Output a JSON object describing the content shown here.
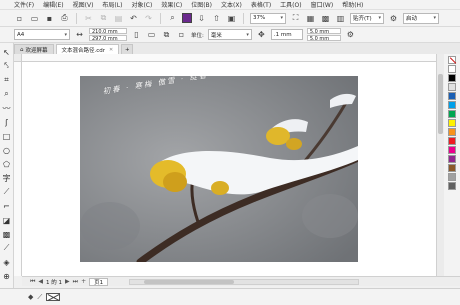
{
  "menu": [
    "文件(F)",
    "编辑(E)",
    "视图(V)",
    "布局(L)",
    "对象(C)",
    "效果(C)",
    "位图(B)",
    "文本(X)",
    "表格(T)",
    "工具(O)",
    "窗口(W)",
    "帮助(H)"
  ],
  "toolbar": {
    "zoom": "37%",
    "snap": "贴齐(T)",
    "launch": "启动"
  },
  "propertybar": {
    "paper": "A4",
    "width": "210.0 mm",
    "height": "297.0 mm",
    "units_label": "单位:",
    "units_value": "毫米",
    "nudge": ".1 mm",
    "dup_x": "5.0 mm",
    "dup_y": "5.0 mm"
  },
  "tabs": {
    "welcome": "欢迎屏幕",
    "document": "文本混合路径.cdr"
  },
  "photo": {
    "caption": "初春 · 寒梅 傲雪 · 绽香"
  },
  "pagebar": {
    "page_counter": "1 的 1",
    "page_tab": "页1"
  },
  "colors": {
    "accent": "#6b2a8e",
    "palette": [
      "#ffffff",
      "#000000",
      "#e0e0e0",
      "#1a5fb4",
      "#00a0e9",
      "#00a651",
      "#fff200",
      "#f7941d",
      "#ed1c24",
      "#ec008c",
      "#92278f",
      "#8b5a2b",
      "#a0a0a0",
      "#606060"
    ]
  }
}
